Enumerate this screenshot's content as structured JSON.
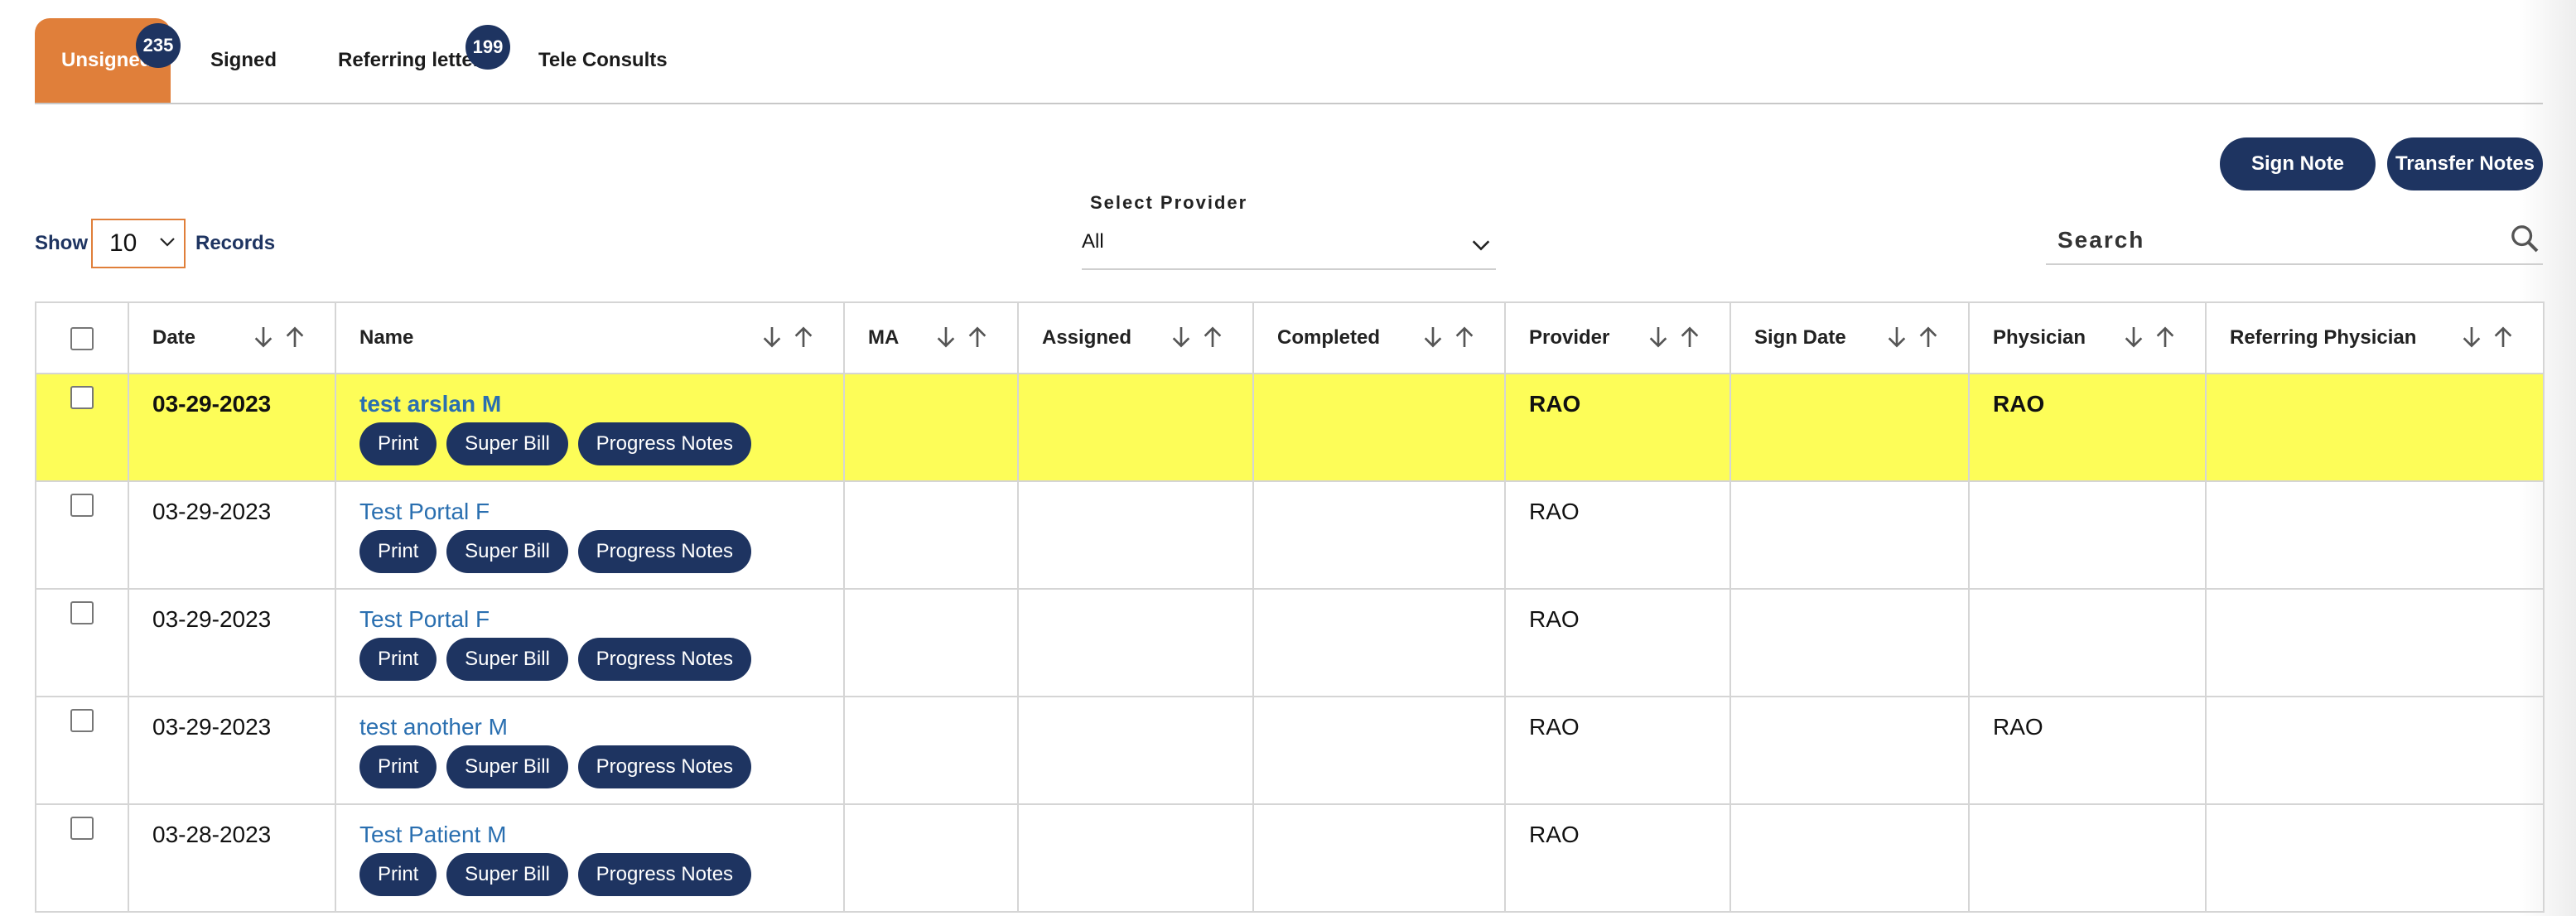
{
  "tabs": [
    {
      "label": "Unsigned",
      "badge": "235"
    },
    {
      "label": "Signed"
    },
    {
      "label": "Referring letter",
      "badge": "199"
    },
    {
      "label": "Tele Consults"
    }
  ],
  "toolbar": {
    "sign_note": "Sign Note",
    "transfer_notes": "Transfer Notes"
  },
  "page_size": {
    "show": "Show",
    "value": "10",
    "records": "Records"
  },
  "provider_filter": {
    "label": "Select Provider",
    "value": "All"
  },
  "search": {
    "placeholder": "Search"
  },
  "table": {
    "columns": [
      "Date",
      "Name",
      "MA",
      "Assigned",
      "Completed",
      "Provider",
      "Sign Date",
      "Physician",
      "Referring Physician"
    ],
    "actions": [
      "Print",
      "Super Bill",
      "Progress Notes"
    ],
    "rows": [
      {
        "date": "03-29-2023",
        "name": "test arslan M",
        "ma": "",
        "assigned": "",
        "completed": "",
        "provider": "RAO",
        "sign_date": "",
        "physician": "RAO",
        "referring": "",
        "highlighted": true
      },
      {
        "date": "03-29-2023",
        "name": "Test Portal F",
        "ma": "",
        "assigned": "",
        "completed": "",
        "provider": "RAO",
        "sign_date": "",
        "physician": "",
        "referring": ""
      },
      {
        "date": "03-29-2023",
        "name": "Test Portal F",
        "ma": "",
        "assigned": "",
        "completed": "",
        "provider": "RAO",
        "sign_date": "",
        "physician": "",
        "referring": ""
      },
      {
        "date": "03-29-2023",
        "name": "test another M",
        "ma": "",
        "assigned": "",
        "completed": "",
        "provider": "RAO",
        "sign_date": "",
        "physician": "RAO",
        "referring": ""
      },
      {
        "date": "03-28-2023",
        "name": "Test Patient M",
        "ma": "",
        "assigned": "",
        "completed": "",
        "provider": "RAO",
        "sign_date": "",
        "physician": "",
        "referring": ""
      }
    ]
  },
  "colors": {
    "accent": "#e07f3a",
    "primary": "#1e3461",
    "highlight": "#fdfd58",
    "link": "#2a6fb0"
  }
}
